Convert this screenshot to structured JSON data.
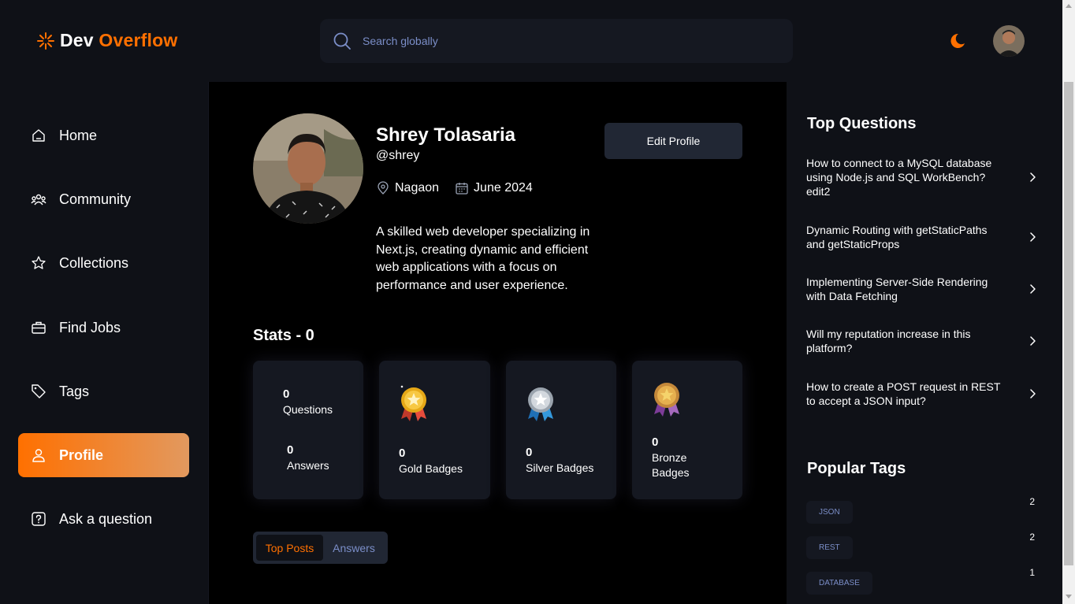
{
  "header": {
    "logo_main": "Dev",
    "logo_accent": "Overflow",
    "search_placeholder": "Search globally"
  },
  "sidebar": {
    "items": [
      {
        "label": "Home",
        "icon": "home-icon"
      },
      {
        "label": "Community",
        "icon": "community-icon"
      },
      {
        "label": "Collections",
        "icon": "star-icon"
      },
      {
        "label": "Find Jobs",
        "icon": "suitcase-icon"
      },
      {
        "label": "Tags",
        "icon": "tag-icon"
      },
      {
        "label": "Profile",
        "icon": "user-icon",
        "active": true
      },
      {
        "label": "Ask a question",
        "icon": "question-icon"
      }
    ]
  },
  "profile": {
    "name": "Shrey Tolasaria",
    "handle": "@shrey",
    "location": "Nagaon",
    "joined": "June 2024",
    "bio": "A skilled web developer specializing in Next.js, creating dynamic and efficient web applications with a focus on performance and user experience.",
    "edit_label": "Edit Profile"
  },
  "stats": {
    "title": "Stats - 0",
    "questions": {
      "value": "0",
      "label": "Questions"
    },
    "answers": {
      "value": "0",
      "label": "Answers"
    },
    "gold": {
      "value": "0",
      "label": "Gold Badges"
    },
    "silver": {
      "value": "0",
      "label": "Silver Badges"
    },
    "bronze": {
      "value": "0",
      "label": "Bronze Badges"
    }
  },
  "tabs": {
    "top_posts": "Top Posts",
    "answers": "Answers"
  },
  "right_sidebar": {
    "top_questions_title": "Top Questions",
    "questions": [
      "How to connect to a MySQL database using Node.js and SQL WorkBench? edit2",
      "Dynamic Routing with getStaticPaths and getStaticProps",
      "Implementing Server-Side Rendering with Data Fetching",
      "Will my reputation increase in this platform?",
      "How to create a POST request in REST to accept a JSON input?"
    ],
    "popular_tags_title": "Popular Tags",
    "tags": [
      {
        "name": "JSON",
        "count": "2"
      },
      {
        "name": "REST",
        "count": "2"
      },
      {
        "name": "DATABASE",
        "count": "1"
      }
    ]
  },
  "colors": {
    "accent": "#ff7000",
    "background": "#000000",
    "panel": "#0f1117",
    "card": "#151821",
    "muted_blue": "#7b8ec8"
  }
}
